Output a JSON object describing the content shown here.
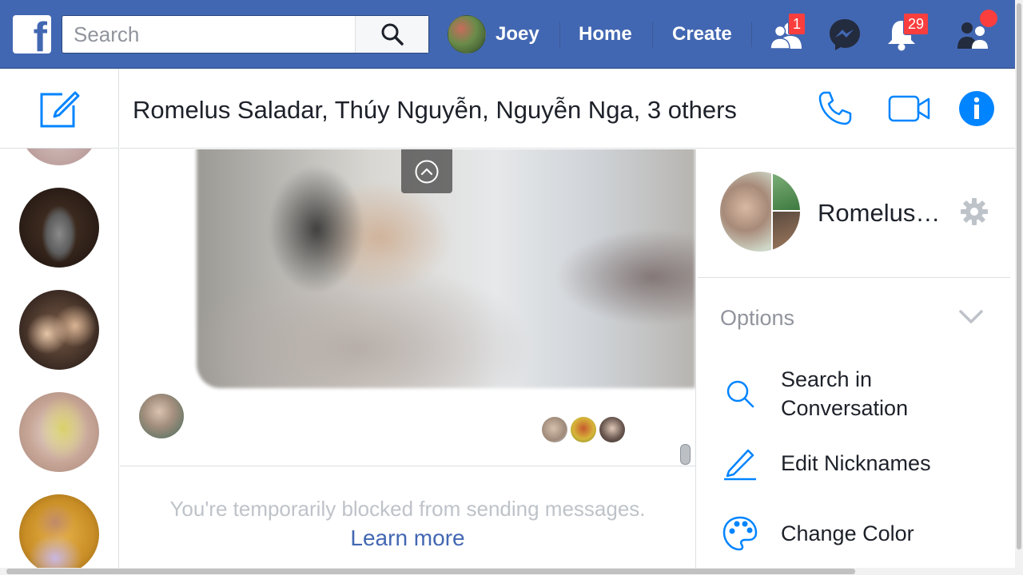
{
  "topbar": {
    "search_placeholder": "Search",
    "profile_name": "Joey",
    "home_label": "Home",
    "create_label": "Create",
    "friend_requests_count": "1",
    "notifications_count": "29",
    "brand_color": "#4267b2",
    "badge_color": "#fa3e3e"
  },
  "conversation": {
    "title": "Romelus Saladar, Thúy Nguyễn, Nguyễn Nga, 3 others",
    "blocked_text": "You're temporarily blocked from sending messages.",
    "learn_more": "Learn more"
  },
  "panel": {
    "group_name": "Romelus…",
    "options_label": "Options",
    "options": [
      {
        "label_line1": "Search in",
        "label_line2": "Conversation",
        "icon": "search-icon"
      },
      {
        "label": "Edit Nicknames",
        "icon": "pencil-icon"
      },
      {
        "label": "Change Color",
        "icon": "palette-icon"
      }
    ],
    "accent_color": "#0084ff"
  }
}
